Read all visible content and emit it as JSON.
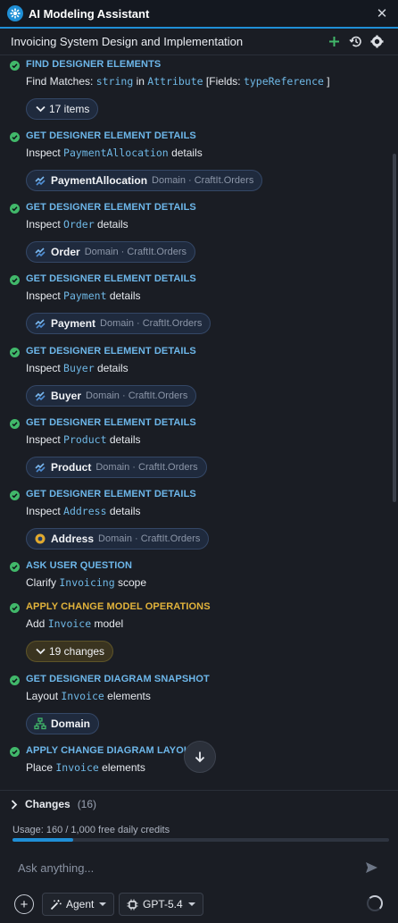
{
  "window": {
    "title": "AI Modeling Assistant",
    "close_glyph": "✕"
  },
  "session": {
    "title": "Invoicing System Design and Implementation",
    "icons": [
      "plus-icon",
      "history-icon",
      "gear-icon"
    ]
  },
  "steps": [
    {
      "kind": "FIND DESIGNER ELEMENTS",
      "tone": "info",
      "line": [
        {
          "t": "Find Matches: "
        },
        {
          "t": "string",
          "code": true
        },
        {
          "t": " in "
        },
        {
          "t": "Attribute",
          "code": true
        },
        {
          "t": " [Fields: "
        },
        {
          "t": "typeReference",
          "code": true
        },
        {
          "t": " ]"
        }
      ],
      "chip": {
        "type": "expand",
        "label": "17 items"
      }
    },
    {
      "kind": "GET DESIGNER ELEMENT DETAILS",
      "tone": "info",
      "line": [
        {
          "t": "Inspect "
        },
        {
          "t": "PaymentAllocation",
          "code": true
        },
        {
          "t": " details"
        }
      ],
      "chip": {
        "type": "element",
        "icon": "entity-icon",
        "label": "PaymentAllocation",
        "meta": "Domain · CraftIt.Orders"
      }
    },
    {
      "kind": "GET DESIGNER ELEMENT DETAILS",
      "tone": "info",
      "line": [
        {
          "t": "Inspect "
        },
        {
          "t": "Order",
          "code": true
        },
        {
          "t": " details"
        }
      ],
      "chip": {
        "type": "element",
        "icon": "entity-icon",
        "label": "Order",
        "meta": "Domain · CraftIt.Orders"
      }
    },
    {
      "kind": "GET DESIGNER ELEMENT DETAILS",
      "tone": "info",
      "line": [
        {
          "t": "Inspect "
        },
        {
          "t": "Payment",
          "code": true
        },
        {
          "t": " details"
        }
      ],
      "chip": {
        "type": "element",
        "icon": "entity-icon",
        "label": "Payment",
        "meta": "Domain · CraftIt.Orders"
      }
    },
    {
      "kind": "GET DESIGNER ELEMENT DETAILS",
      "tone": "info",
      "line": [
        {
          "t": "Inspect "
        },
        {
          "t": "Buyer",
          "code": true
        },
        {
          "t": " details"
        }
      ],
      "chip": {
        "type": "element",
        "icon": "entity-icon",
        "label": "Buyer",
        "meta": "Domain · CraftIt.Orders"
      }
    },
    {
      "kind": "GET DESIGNER ELEMENT DETAILS",
      "tone": "info",
      "line": [
        {
          "t": "Inspect "
        },
        {
          "t": "Product",
          "code": true
        },
        {
          "t": " details"
        }
      ],
      "chip": {
        "type": "element",
        "icon": "entity-icon",
        "label": "Product",
        "meta": "Domain · CraftIt.Orders"
      }
    },
    {
      "kind": "GET DESIGNER ELEMENT DETAILS",
      "tone": "info",
      "line": [
        {
          "t": "Inspect "
        },
        {
          "t": "Address",
          "code": true
        },
        {
          "t": " details"
        }
      ],
      "chip": {
        "type": "element",
        "icon": "value-object-icon",
        "label": "Address",
        "meta": "Domain · CraftIt.Orders"
      }
    },
    {
      "kind": "ASK USER QUESTION",
      "tone": "info",
      "line": [
        {
          "t": "Clarify "
        },
        {
          "t": "Invoicing",
          "code": true
        },
        {
          "t": " scope"
        }
      ]
    },
    {
      "kind": "APPLY CHANGE MODEL OPERATIONS",
      "tone": "warn",
      "line": [
        {
          "t": "Add "
        },
        {
          "t": "Invoice",
          "code": true
        },
        {
          "t": " model"
        }
      ],
      "chip": {
        "type": "expand",
        "label": "19 changes",
        "tone": "warn"
      }
    },
    {
      "kind": "GET DESIGNER DIAGRAM SNAPSHOT",
      "tone": "info",
      "line": [
        {
          "t": "Layout "
        },
        {
          "t": "Invoice",
          "code": true
        },
        {
          "t": " elements"
        }
      ],
      "chip": {
        "type": "element",
        "icon": "diagram-icon",
        "label": "Domain",
        "meta": ""
      }
    },
    {
      "kind": "APPLY CHANGE DIAGRAM LAYOUT",
      "tone": "info",
      "line": [
        {
          "t": "Place "
        },
        {
          "t": "Invoice",
          "code": true
        },
        {
          "t": " elements"
        }
      ]
    }
  ],
  "changes": {
    "label": "Changes",
    "count": "(16)"
  },
  "usage": {
    "text": "Usage: 160 / 1,000 free daily credits",
    "used": 160,
    "total": 1000
  },
  "input": {
    "placeholder": "Ask anything...",
    "value": ""
  },
  "toolbar": {
    "mode_label": "Agent",
    "model_label": "GPT-5.4"
  },
  "colors": {
    "accent": "#1f8fd6",
    "success": "#41b86a",
    "warning": "#e2b33b",
    "link": "#6db7ea"
  }
}
